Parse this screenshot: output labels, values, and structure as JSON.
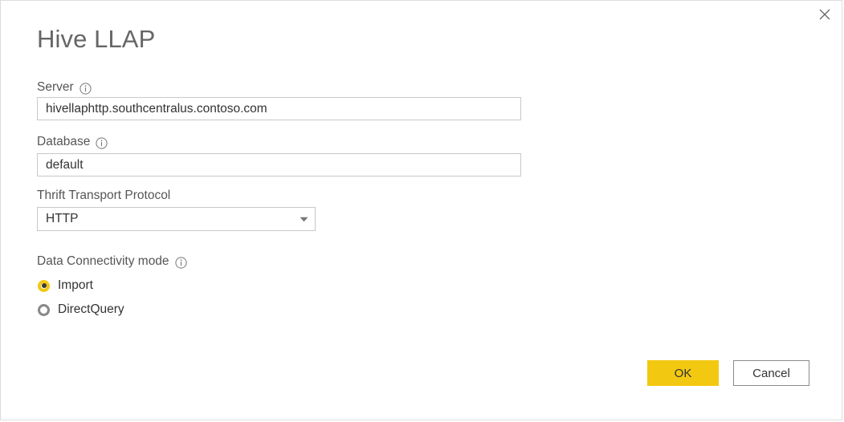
{
  "dialog": {
    "title": "Hive LLAP",
    "close_icon": "close-icon"
  },
  "fields": {
    "server": {
      "label": "Server",
      "info_icon": "info-icon",
      "value": "hivellaphttp.southcentralus.contoso.com",
      "placeholder": ""
    },
    "database": {
      "label": "Database",
      "info_icon": "info-icon",
      "value": "default",
      "placeholder": ""
    },
    "thrift_transport_protocol": {
      "label": "Thrift Transport Protocol",
      "value": "HTTP",
      "options": [
        "HTTP"
      ],
      "arrow_icon": "chevron-down-icon"
    }
  },
  "connectivity": {
    "label": "Data Connectivity mode",
    "info_icon": "info-icon",
    "options": [
      {
        "label": "Import",
        "selected": true
      },
      {
        "label": "DirectQuery",
        "selected": false
      }
    ]
  },
  "footer": {
    "ok_label": "OK",
    "cancel_label": "Cancel"
  },
  "colors": {
    "accent": "#f2c811",
    "title_text": "#666666",
    "label_text": "#555555",
    "value_text": "#333333",
    "input_border": "#c8c8c8",
    "button_border": "#8a8a8a",
    "dialog_border": "#dcdcdc",
    "radio_unselected": "#888888"
  }
}
